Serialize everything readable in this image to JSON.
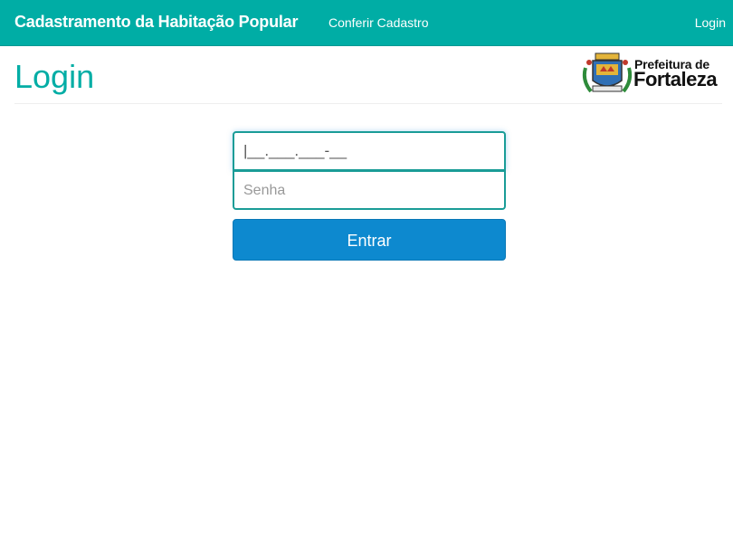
{
  "navbar": {
    "brand": "Cadastramento da Habitação Popular",
    "links": [
      "Conferir Cadastro"
    ],
    "right_link": "Login"
  },
  "header": {
    "title": "Login",
    "logo": {
      "line1": "Prefeitura de",
      "line2": "Fortaleza",
      "icon": "fortaleza-coat-of-arms-icon"
    }
  },
  "form": {
    "cpf_value": "|__.___.___-__",
    "password_placeholder": "Senha",
    "submit_label": "Entrar"
  },
  "colors": {
    "primary": "#00ada5",
    "button": "#0d89cf"
  }
}
